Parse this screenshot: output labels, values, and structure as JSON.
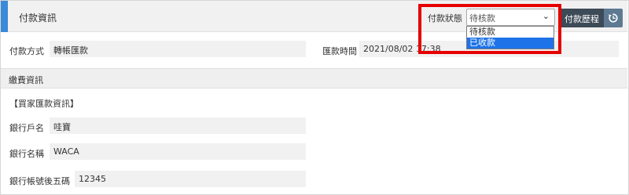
{
  "header": {
    "title": "付款資訊",
    "status_label": "付款狀態",
    "status_selected": "待核款",
    "status_options": [
      "待核款",
      "已收款"
    ],
    "history_button_label": "付款歷程",
    "history_icon": "refresh-history-icon"
  },
  "payment": {
    "method_label": "付款方式",
    "method_value": "轉帳匯款",
    "time_label": "匯款時間",
    "time_value": "2021/08/02 17:38"
  },
  "fee_section": {
    "title": "繳費資訊",
    "buyer_heading": "【買家匯款資訊】",
    "fields": [
      {
        "label": "銀行戶名",
        "value": "哇寶"
      },
      {
        "label": "銀行名稱",
        "value": "WACA"
      },
      {
        "label": "銀行帳號後五碼",
        "value": "12345"
      }
    ]
  },
  "colors": {
    "accent": "#3b8ad9",
    "button_dark": "#3d4a57",
    "button_icon": "#5e7a93",
    "highlight": "#e60000",
    "option_selected": "#1e73e8"
  }
}
